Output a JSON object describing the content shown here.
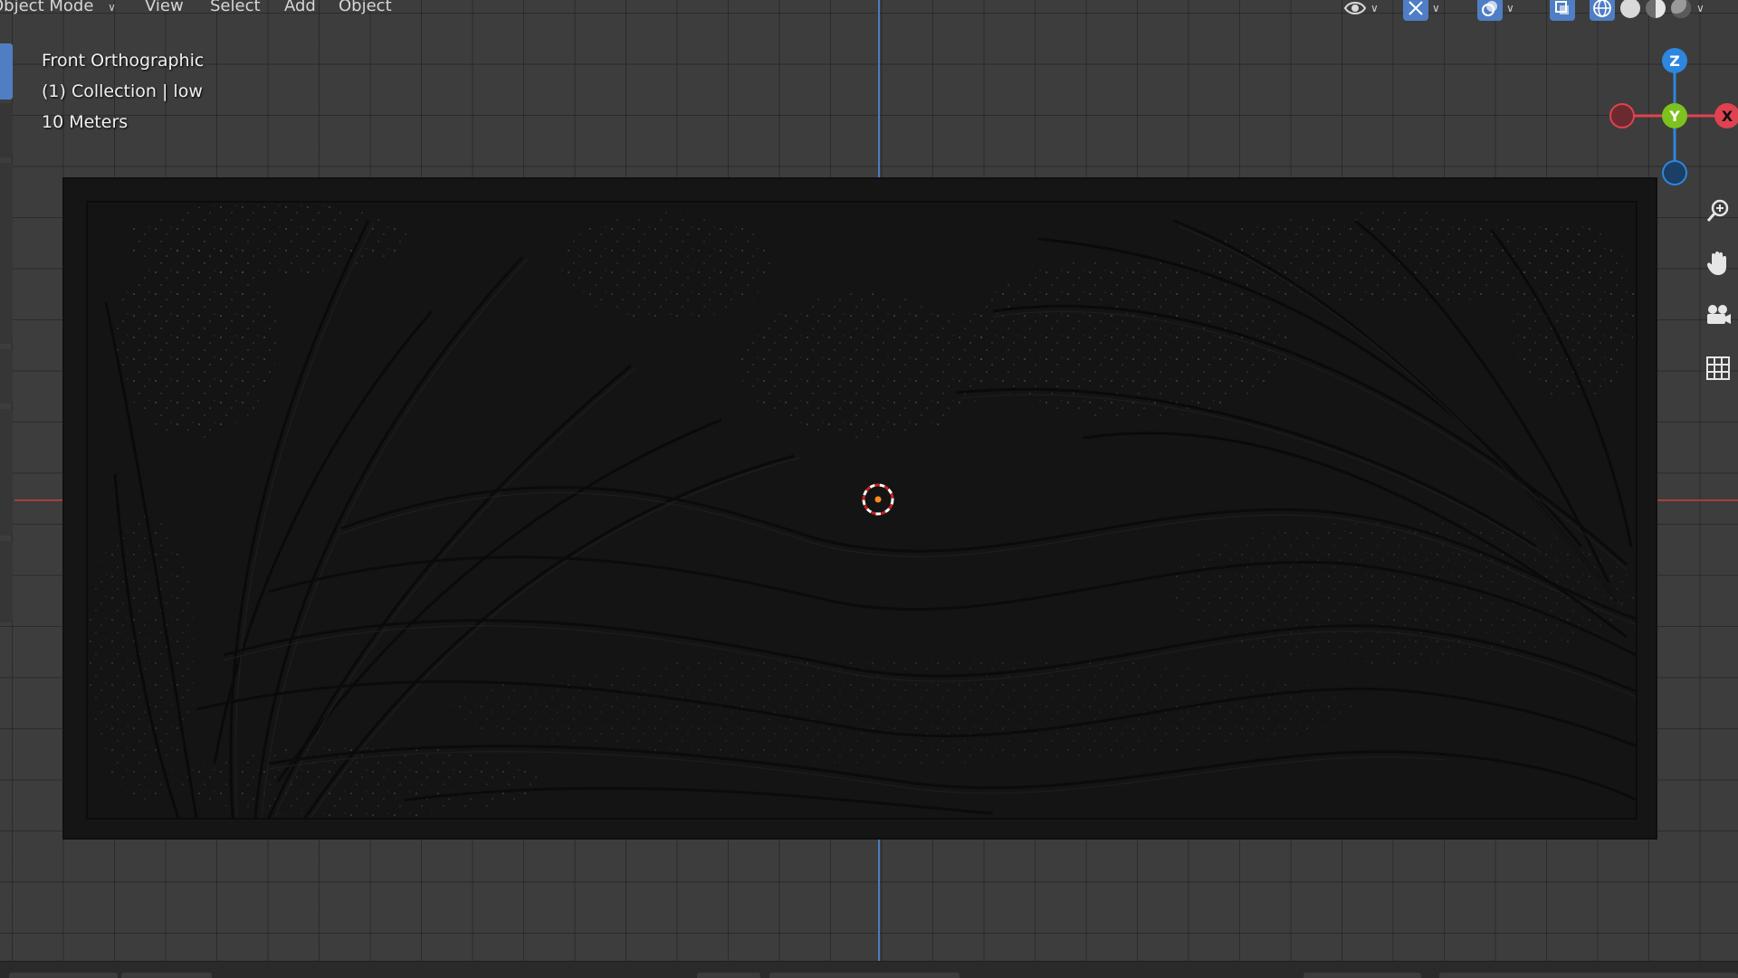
{
  "header": {
    "mode_label": "Object Mode",
    "menus": [
      "View",
      "Select",
      "Add",
      "Object"
    ]
  },
  "overlay": {
    "view_name": "Front Orthographic",
    "collection": "(1) Collection | low",
    "scale": "10 Meters"
  },
  "gizmo": {
    "z": "Z",
    "y": "Y",
    "x": "X"
  },
  "icons": {
    "visibility": "eye-icon",
    "gizmo_toggle": "gizmo-icon",
    "overlays": "overlays-icon",
    "xray": "xray-icon",
    "wireframe": "wireframe-shading-icon",
    "solid": "solid-shading-icon",
    "material": "material-shading-icon",
    "rendered": "rendered-shading-icon",
    "zoom": "zoom-icon",
    "pan": "hand-icon",
    "camera": "camera-icon",
    "ortho": "grid-icon"
  },
  "colors": {
    "x_axis": "#a33f3f",
    "z_axis": "#4a7bc0",
    "gizmo_x": "#e0424f",
    "gizmo_y": "#7dc21e",
    "gizmo_z": "#2d86e0",
    "active_button": "#4f7ec4"
  }
}
